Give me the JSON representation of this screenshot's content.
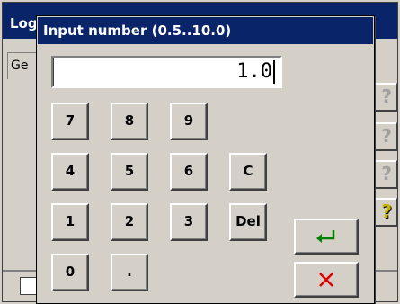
{
  "background": {
    "window_title": "Log",
    "tab_label": "Ge",
    "help_icons": [
      "question-icon",
      "question-icon",
      "question-icon",
      "question-icon-highlighted"
    ]
  },
  "dialog": {
    "title": "Input number (0.5..10.0)",
    "display_value": "1.0",
    "keys": {
      "k7": "7",
      "k8": "8",
      "k9": "9",
      "k4": "4",
      "k5": "5",
      "k6": "6",
      "k1": "1",
      "k2": "2",
      "k3": "3",
      "k0": "0",
      "dot": ".",
      "clear": "C",
      "delete": "Del"
    },
    "enter_icon": "enter-arrow-icon",
    "cancel_icon": "close-x-icon",
    "colors": {
      "enter": "#008000",
      "cancel": "#e00000",
      "title_bar": "#0a246a"
    }
  }
}
